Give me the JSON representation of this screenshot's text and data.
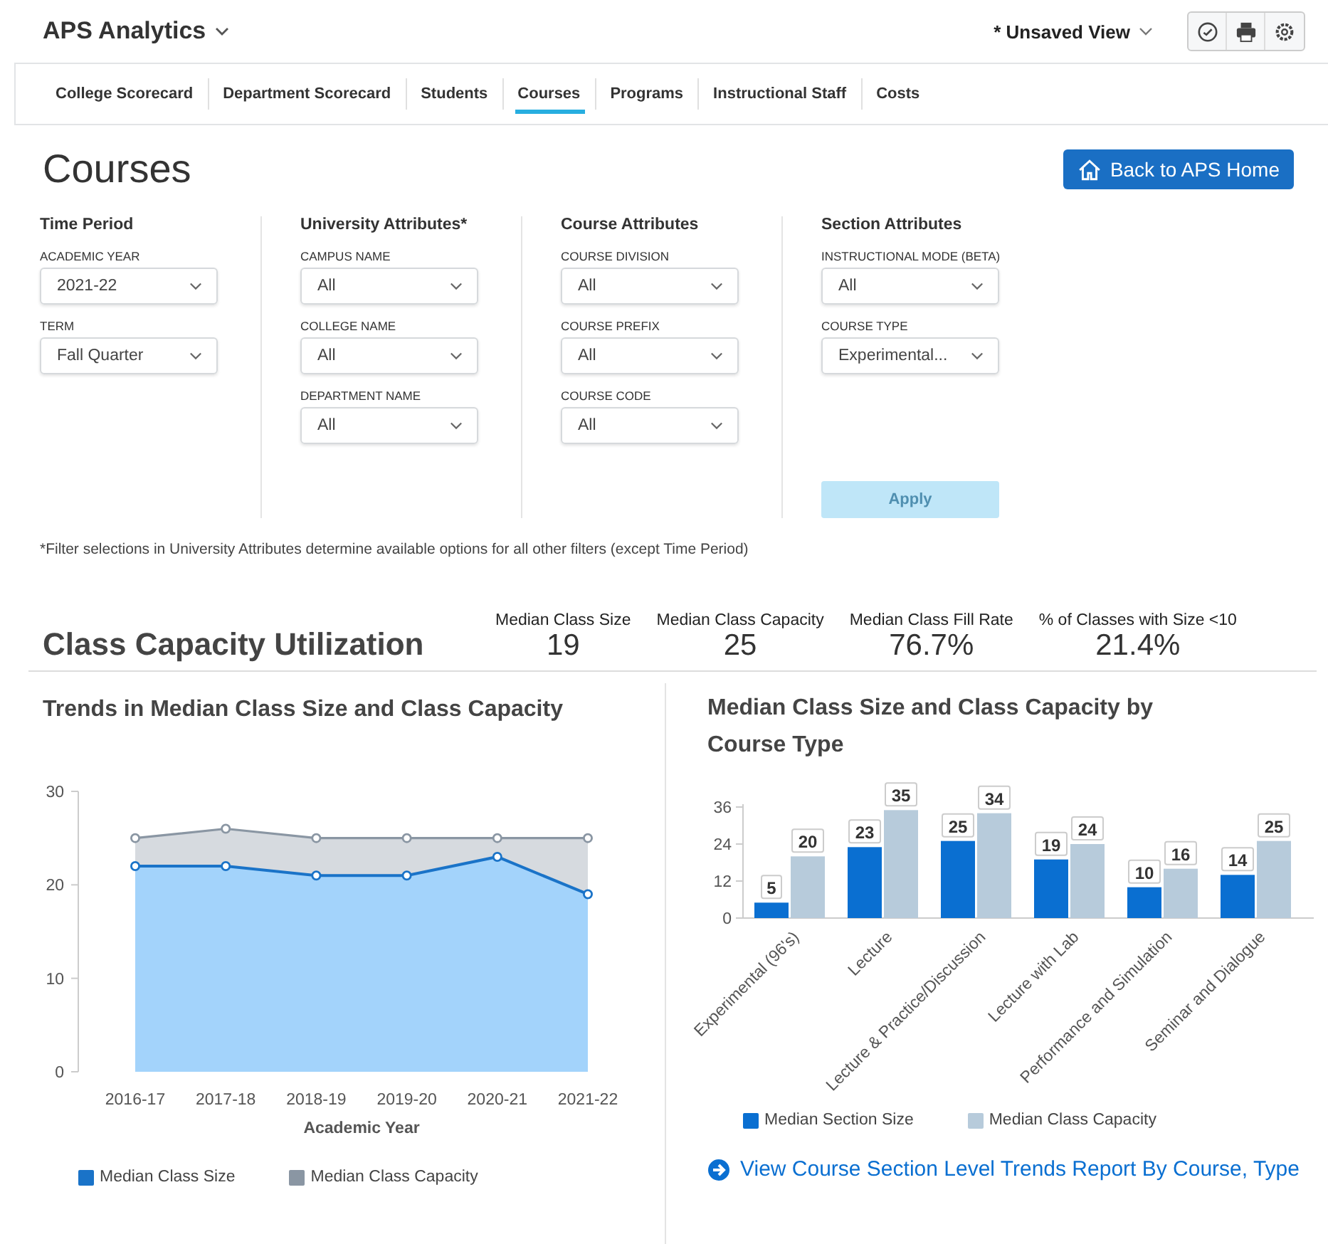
{
  "header": {
    "app_title": "APS Analytics",
    "view_name": "* Unsaved View"
  },
  "tabs": [
    {
      "label": "College Scorecard",
      "selected": false
    },
    {
      "label": "Department Scorecard",
      "selected": false
    },
    {
      "label": "Students",
      "selected": false
    },
    {
      "label": "Courses",
      "selected": true
    },
    {
      "label": "Programs",
      "selected": false
    },
    {
      "label": "Instructional Staff",
      "selected": false
    },
    {
      "label": "Costs",
      "selected": false
    }
  ],
  "page": {
    "title": "Courses",
    "back_button": "Back to APS Home"
  },
  "filters": {
    "groups": [
      {
        "title": "Time Period",
        "fields": [
          {
            "label": "ACADEMIC YEAR",
            "value": "2021-22"
          },
          {
            "label": "TERM",
            "value": "Fall Quarter"
          }
        ]
      },
      {
        "title": "University Attributes*",
        "fields": [
          {
            "label": "CAMPUS NAME",
            "value": "All"
          },
          {
            "label": "COLLEGE NAME",
            "value": "All"
          },
          {
            "label": "DEPARTMENT NAME",
            "value": "All"
          }
        ]
      },
      {
        "title": "Course Attributes",
        "fields": [
          {
            "label": "COURSE DIVISION",
            "value": "All"
          },
          {
            "label": "COURSE PREFIX",
            "value": "All"
          },
          {
            "label": "COURSE CODE",
            "value": "All"
          }
        ]
      },
      {
        "title": "Section Attributes",
        "fields": [
          {
            "label": "INSTRUCTIONAL MODE (BETA)",
            "value": "All"
          },
          {
            "label": "COURSE TYPE",
            "value": "Experimental..."
          }
        ]
      }
    ],
    "apply_button": {
      "label": "Apply",
      "disabled": true
    },
    "footnote": "*Filter selections in University Attributes determine available options for all other filters (except Time Period)"
  },
  "utilization": {
    "title": "Class Capacity Utilization",
    "stats": [
      {
        "label": "Median Class Size",
        "value": "19"
      },
      {
        "label": "Median Class Capacity",
        "value": "25"
      },
      {
        "label": "Median Class Fill Rate",
        "value": "76.7%"
      },
      {
        "label": "% of Classes with Size <10",
        "value": "21.4%"
      }
    ]
  },
  "trend_panel": {
    "chart_data": {
      "type": "area",
      "title": "Trends in Median Class Size and Class Capacity",
      "xlabel": "Academic Year",
      "categories": [
        "2016-17",
        "2017-18",
        "2018-19",
        "2019-20",
        "2020-21",
        "2021-22"
      ],
      "ylim": [
        0,
        30
      ],
      "yticks": [
        0,
        10,
        20,
        30
      ],
      "series": [
        {
          "name": "Median Class Size",
          "color": "#1a73c8",
          "values": [
            22,
            22,
            21,
            21,
            23,
            19
          ]
        },
        {
          "name": "Median Class Capacity",
          "color": "#8a96a3",
          "values": [
            25,
            26,
            25,
            25,
            25,
            25
          ]
        }
      ]
    }
  },
  "type_panel": {
    "chart_data": {
      "type": "bar",
      "title": "Median Class Size and Class Capacity by Course Type",
      "categories": [
        "Experimental (96's)",
        "Lecture",
        "Lecture & Practice/Discussion",
        "Lecture with Lab",
        "Performance and Simulation",
        "Seminar and Dialogue"
      ],
      "ylim": [
        0,
        36
      ],
      "yticks": [
        0,
        12,
        24,
        36
      ],
      "data_labels": true,
      "series": [
        {
          "name": "Median Section Size",
          "color": "#0a6fd1",
          "values": [
            5,
            23,
            25,
            19,
            10,
            14
          ]
        },
        {
          "name": "Median Class Capacity",
          "color": "#b7cbdb",
          "values": [
            20,
            35,
            34,
            24,
            16,
            25
          ]
        }
      ]
    },
    "link": "View Course Section Level Trends Report By Course, Type"
  }
}
